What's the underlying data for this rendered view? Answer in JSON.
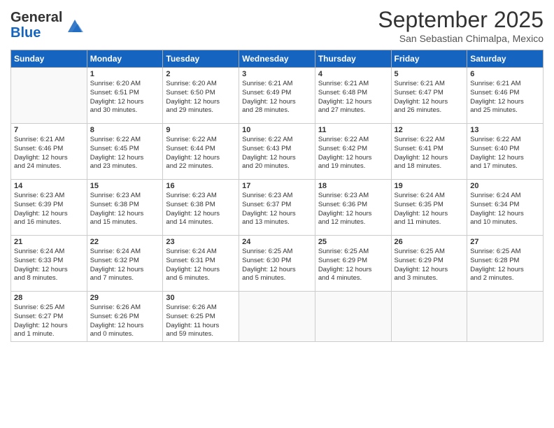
{
  "header": {
    "logo_general": "General",
    "logo_blue": "Blue",
    "month": "September 2025",
    "location": "San Sebastian Chimalpa, Mexico"
  },
  "weekdays": [
    "Sunday",
    "Monday",
    "Tuesday",
    "Wednesday",
    "Thursday",
    "Friday",
    "Saturday"
  ],
  "weeks": [
    [
      {
        "day": null,
        "content": null
      },
      {
        "day": "1",
        "content": "Sunrise: 6:20 AM\nSunset: 6:51 PM\nDaylight: 12 hours\nand 30 minutes."
      },
      {
        "day": "2",
        "content": "Sunrise: 6:20 AM\nSunset: 6:50 PM\nDaylight: 12 hours\nand 29 minutes."
      },
      {
        "day": "3",
        "content": "Sunrise: 6:21 AM\nSunset: 6:49 PM\nDaylight: 12 hours\nand 28 minutes."
      },
      {
        "day": "4",
        "content": "Sunrise: 6:21 AM\nSunset: 6:48 PM\nDaylight: 12 hours\nand 27 minutes."
      },
      {
        "day": "5",
        "content": "Sunrise: 6:21 AM\nSunset: 6:47 PM\nDaylight: 12 hours\nand 26 minutes."
      },
      {
        "day": "6",
        "content": "Sunrise: 6:21 AM\nSunset: 6:46 PM\nDaylight: 12 hours\nand 25 minutes."
      }
    ],
    [
      {
        "day": "7",
        "content": "Sunrise: 6:21 AM\nSunset: 6:46 PM\nDaylight: 12 hours\nand 24 minutes."
      },
      {
        "day": "8",
        "content": "Sunrise: 6:22 AM\nSunset: 6:45 PM\nDaylight: 12 hours\nand 23 minutes."
      },
      {
        "day": "9",
        "content": "Sunrise: 6:22 AM\nSunset: 6:44 PM\nDaylight: 12 hours\nand 22 minutes."
      },
      {
        "day": "10",
        "content": "Sunrise: 6:22 AM\nSunset: 6:43 PM\nDaylight: 12 hours\nand 20 minutes."
      },
      {
        "day": "11",
        "content": "Sunrise: 6:22 AM\nSunset: 6:42 PM\nDaylight: 12 hours\nand 19 minutes."
      },
      {
        "day": "12",
        "content": "Sunrise: 6:22 AM\nSunset: 6:41 PM\nDaylight: 12 hours\nand 18 minutes."
      },
      {
        "day": "13",
        "content": "Sunrise: 6:22 AM\nSunset: 6:40 PM\nDaylight: 12 hours\nand 17 minutes."
      }
    ],
    [
      {
        "day": "14",
        "content": "Sunrise: 6:23 AM\nSunset: 6:39 PM\nDaylight: 12 hours\nand 16 minutes."
      },
      {
        "day": "15",
        "content": "Sunrise: 6:23 AM\nSunset: 6:38 PM\nDaylight: 12 hours\nand 15 minutes."
      },
      {
        "day": "16",
        "content": "Sunrise: 6:23 AM\nSunset: 6:38 PM\nDaylight: 12 hours\nand 14 minutes."
      },
      {
        "day": "17",
        "content": "Sunrise: 6:23 AM\nSunset: 6:37 PM\nDaylight: 12 hours\nand 13 minutes."
      },
      {
        "day": "18",
        "content": "Sunrise: 6:23 AM\nSunset: 6:36 PM\nDaylight: 12 hours\nand 12 minutes."
      },
      {
        "day": "19",
        "content": "Sunrise: 6:24 AM\nSunset: 6:35 PM\nDaylight: 12 hours\nand 11 minutes."
      },
      {
        "day": "20",
        "content": "Sunrise: 6:24 AM\nSunset: 6:34 PM\nDaylight: 12 hours\nand 10 minutes."
      }
    ],
    [
      {
        "day": "21",
        "content": "Sunrise: 6:24 AM\nSunset: 6:33 PM\nDaylight: 12 hours\nand 8 minutes."
      },
      {
        "day": "22",
        "content": "Sunrise: 6:24 AM\nSunset: 6:32 PM\nDaylight: 12 hours\nand 7 minutes."
      },
      {
        "day": "23",
        "content": "Sunrise: 6:24 AM\nSunset: 6:31 PM\nDaylight: 12 hours\nand 6 minutes."
      },
      {
        "day": "24",
        "content": "Sunrise: 6:25 AM\nSunset: 6:30 PM\nDaylight: 12 hours\nand 5 minutes."
      },
      {
        "day": "25",
        "content": "Sunrise: 6:25 AM\nSunset: 6:29 PM\nDaylight: 12 hours\nand 4 minutes."
      },
      {
        "day": "26",
        "content": "Sunrise: 6:25 AM\nSunset: 6:29 PM\nDaylight: 12 hours\nand 3 minutes."
      },
      {
        "day": "27",
        "content": "Sunrise: 6:25 AM\nSunset: 6:28 PM\nDaylight: 12 hours\nand 2 minutes."
      }
    ],
    [
      {
        "day": "28",
        "content": "Sunrise: 6:25 AM\nSunset: 6:27 PM\nDaylight: 12 hours\nand 1 minute."
      },
      {
        "day": "29",
        "content": "Sunrise: 6:26 AM\nSunset: 6:26 PM\nDaylight: 12 hours\nand 0 minutes."
      },
      {
        "day": "30",
        "content": "Sunrise: 6:26 AM\nSunset: 6:25 PM\nDaylight: 11 hours\nand 59 minutes."
      },
      {
        "day": null,
        "content": null
      },
      {
        "day": null,
        "content": null
      },
      {
        "day": null,
        "content": null
      },
      {
        "day": null,
        "content": null
      }
    ]
  ]
}
